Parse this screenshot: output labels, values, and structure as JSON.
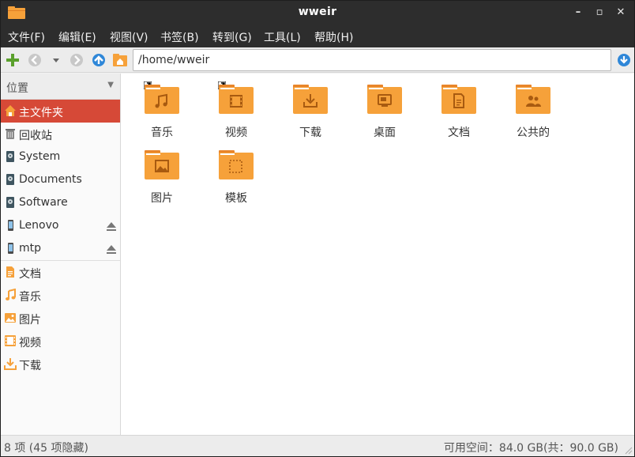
{
  "window": {
    "title": "wweir",
    "controls": {
      "minimize": "–",
      "maximize": "▫",
      "close": "✕"
    }
  },
  "menubar": {
    "items": [
      "文件(F)",
      "编辑(E)",
      "视图(V)",
      "书签(B)",
      "转到(G)",
      "工具(L)",
      "帮助(H)"
    ]
  },
  "toolbar": {
    "path": "/home/wweir",
    "icons": [
      "add-icon",
      "back-icon",
      "history-dropdown-icon",
      "forward-icon",
      "up-icon",
      "home-icon",
      "path-go-icon"
    ]
  },
  "sidebar": {
    "header": "位置",
    "items": [
      {
        "label": "主文件夹",
        "icon": "home-icon"
      },
      {
        "label": "回收站",
        "icon": "trash-icon"
      },
      {
        "label": "System",
        "icon": "drive-icon"
      },
      {
        "label": "Documents",
        "icon": "drive-icon"
      },
      {
        "label": "Software",
        "icon": "drive-icon"
      },
      {
        "label": "Lenovo",
        "icon": "phone-icon"
      },
      {
        "label": "mtp",
        "icon": "phone-icon"
      },
      {
        "label": "文档",
        "icon": "document-icon"
      },
      {
        "label": "音乐",
        "icon": "music-icon"
      },
      {
        "label": "图片",
        "icon": "picture-icon"
      },
      {
        "label": "视频",
        "icon": "video-icon"
      },
      {
        "label": "下载",
        "icon": "download-icon"
      }
    ]
  },
  "files": [
    {
      "label": "音乐",
      "icon": "music-folder-icon"
    },
    {
      "label": "视频",
      "icon": "video-folder-icon"
    },
    {
      "label": "下载",
      "icon": "download-folder-icon"
    },
    {
      "label": "桌面",
      "icon": "desktop-folder-icon"
    },
    {
      "label": "文档",
      "icon": "documents-folder-icon"
    },
    {
      "label": "公共的",
      "icon": "public-folder-icon"
    },
    {
      "label": "图片",
      "icon": "pictures-folder-icon"
    },
    {
      "label": "模板",
      "icon": "templates-folder-icon"
    }
  ],
  "status": {
    "left": "8 项 (45 项隐藏)",
    "right": "可用空间：84.0 GB(共：90.0 GB)"
  },
  "colors": {
    "accent": "#d64937",
    "folder": "#f6a13a",
    "folder_dark": "#e8852a",
    "titlebar": "#2d2d2d"
  }
}
